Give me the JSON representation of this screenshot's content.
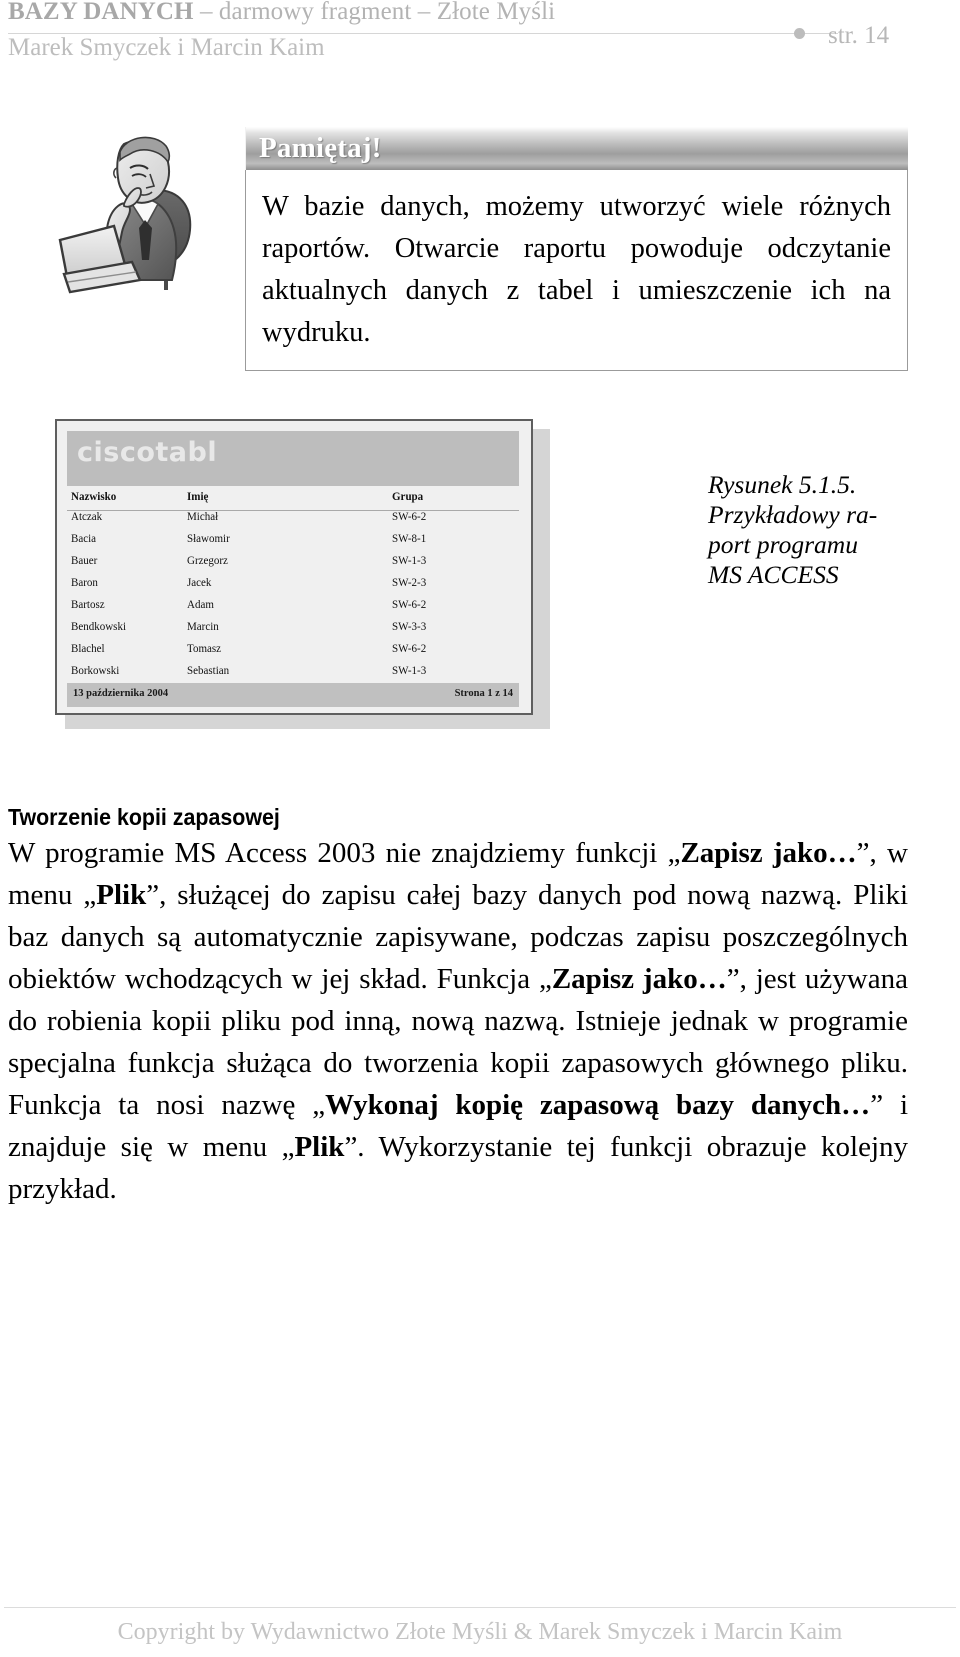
{
  "header": {
    "title_strong": "BAZY DANYCH",
    "title_rest": " – darmowy fragment – Złote Myśli",
    "authors": "Marek Smyczek i Marcin Kaim",
    "page_label": "str. 14"
  },
  "clipart": {
    "alt": "Rysunek przedstawiający mężczyznę myślącego przy laptopie"
  },
  "callout": {
    "title": "Pamiętaj!",
    "text": "W bazie danych, możemy utworzyć wiele różnych raportów. Otwarcie raportu powoduje odczytanie aktualnych danych z tabel i umieszczenie ich na wydruku."
  },
  "report": {
    "db_name": "ciscotabl",
    "columns": [
      "Nazwisko",
      "Imię",
      "Grupa"
    ],
    "rows": [
      [
        "Atczak",
        "Michał",
        "SW-6-2"
      ],
      [
        "Bacia",
        "Sławomir",
        "SW-8-1"
      ],
      [
        "Bauer",
        "Grzegorz",
        "SW-1-3"
      ],
      [
        "Baron",
        "Jacek",
        "SW-2-3"
      ],
      [
        "Bartosz",
        "Adam",
        "SW-6-2"
      ],
      [
        "Bendkowski",
        "Marcin",
        "SW-3-3"
      ],
      [
        "Blachel",
        "Tomasz",
        "SW-6-2"
      ],
      [
        "Borkowski",
        "Sebastian",
        "SW-1-3"
      ]
    ],
    "footer_date": "13 października 2004",
    "footer_page": "Strona 1 z 14"
  },
  "figure": {
    "caption_line1": "Rysunek 5.1.5.",
    "caption_line2": "Przykładowy ra-",
    "caption_line3": "port  programu",
    "caption_line4": "MS ACCESS"
  },
  "section": {
    "heading": "Tworzenie kopii zapasowej"
  },
  "body": {
    "t1": "W programie MS Access 2003 nie znajdziemy funkcji „",
    "b1": "Zapisz jako…",
    "t2": "”, w menu „",
    "b2": "Plik",
    "t3": "”, służącej do zapisu całej bazy danych pod nową nazwą. Pliki baz danych są automatycznie zapisywane, podczas zapisu poszczególnych obiektów wchodzących w jej skład. Funkcja „",
    "b3": "Zapisz jako…",
    "t4": "”, jest używana do robienia kopii pliku pod inną, nową nazwą. Istnieje jednak w programie specjalna funkcja służąca do tworzenia kopii zapasowych głównego pliku. Funkcja ta nosi nazwę „",
    "b4": "Wykonaj kopię zapasową bazy danych…",
    "t5": "” i znajduje się w menu „",
    "b5": "Plik",
    "t6": "”. Wykorzystanie tej funkcji obrazuje kolejny przykład."
  },
  "footer": {
    "copyright": "Copyright by Wydawnictwo Złote Myśli & Marek Smyczek i Marcin Kaim"
  },
  "colors": {
    "header_gray": "#b3b3b3",
    "footer_gray": "#c4c4c4",
    "callout_border": "#9b9b9b",
    "report_band": "#bdbdbd"
  }
}
